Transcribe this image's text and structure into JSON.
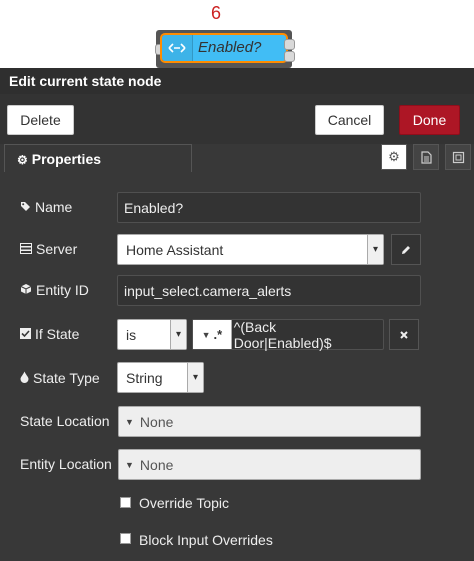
{
  "canvas": {
    "node_number": "6",
    "node_label": "Enabled?"
  },
  "tray": {
    "title": "Edit current state node"
  },
  "toolbar": {
    "delete_label": "Delete",
    "cancel_label": "Cancel",
    "done_label": "Done"
  },
  "tabs": {
    "properties_label": "Properties"
  },
  "form": {
    "name": {
      "label": "Name",
      "value": "Enabled?"
    },
    "server": {
      "label": "Server",
      "value": "Home Assistant"
    },
    "entity_id": {
      "label": "Entity ID",
      "value": "input_select.camera_alerts"
    },
    "if_state": {
      "label": "If State",
      "operator": "is",
      "type_symbol": ".*",
      "value": "^(Back Door|Enabled)$"
    },
    "state_type": {
      "label": "State Type",
      "value": "String"
    },
    "state_location": {
      "label": "State Location",
      "value": "None"
    },
    "entity_location": {
      "label": "Entity Location",
      "value": "None"
    },
    "override_topic": {
      "label": "Override Topic",
      "checked": false
    },
    "block_input_overrides": {
      "label": "Block Input Overrides",
      "checked": false
    }
  },
  "colors": {
    "node_fill": "#41bdf5",
    "node_border": "#ff8c00",
    "done_button": "#ad1625",
    "panel_bg": "#383838"
  },
  "icons": [
    "arrows-icon",
    "gear-icon",
    "tag-icon",
    "server-icon",
    "pencil-icon",
    "cube-icon",
    "checkbox-icon",
    "drop-icon",
    "close-icon",
    "document-icon",
    "frame-icon",
    "caret-down-icon"
  ]
}
